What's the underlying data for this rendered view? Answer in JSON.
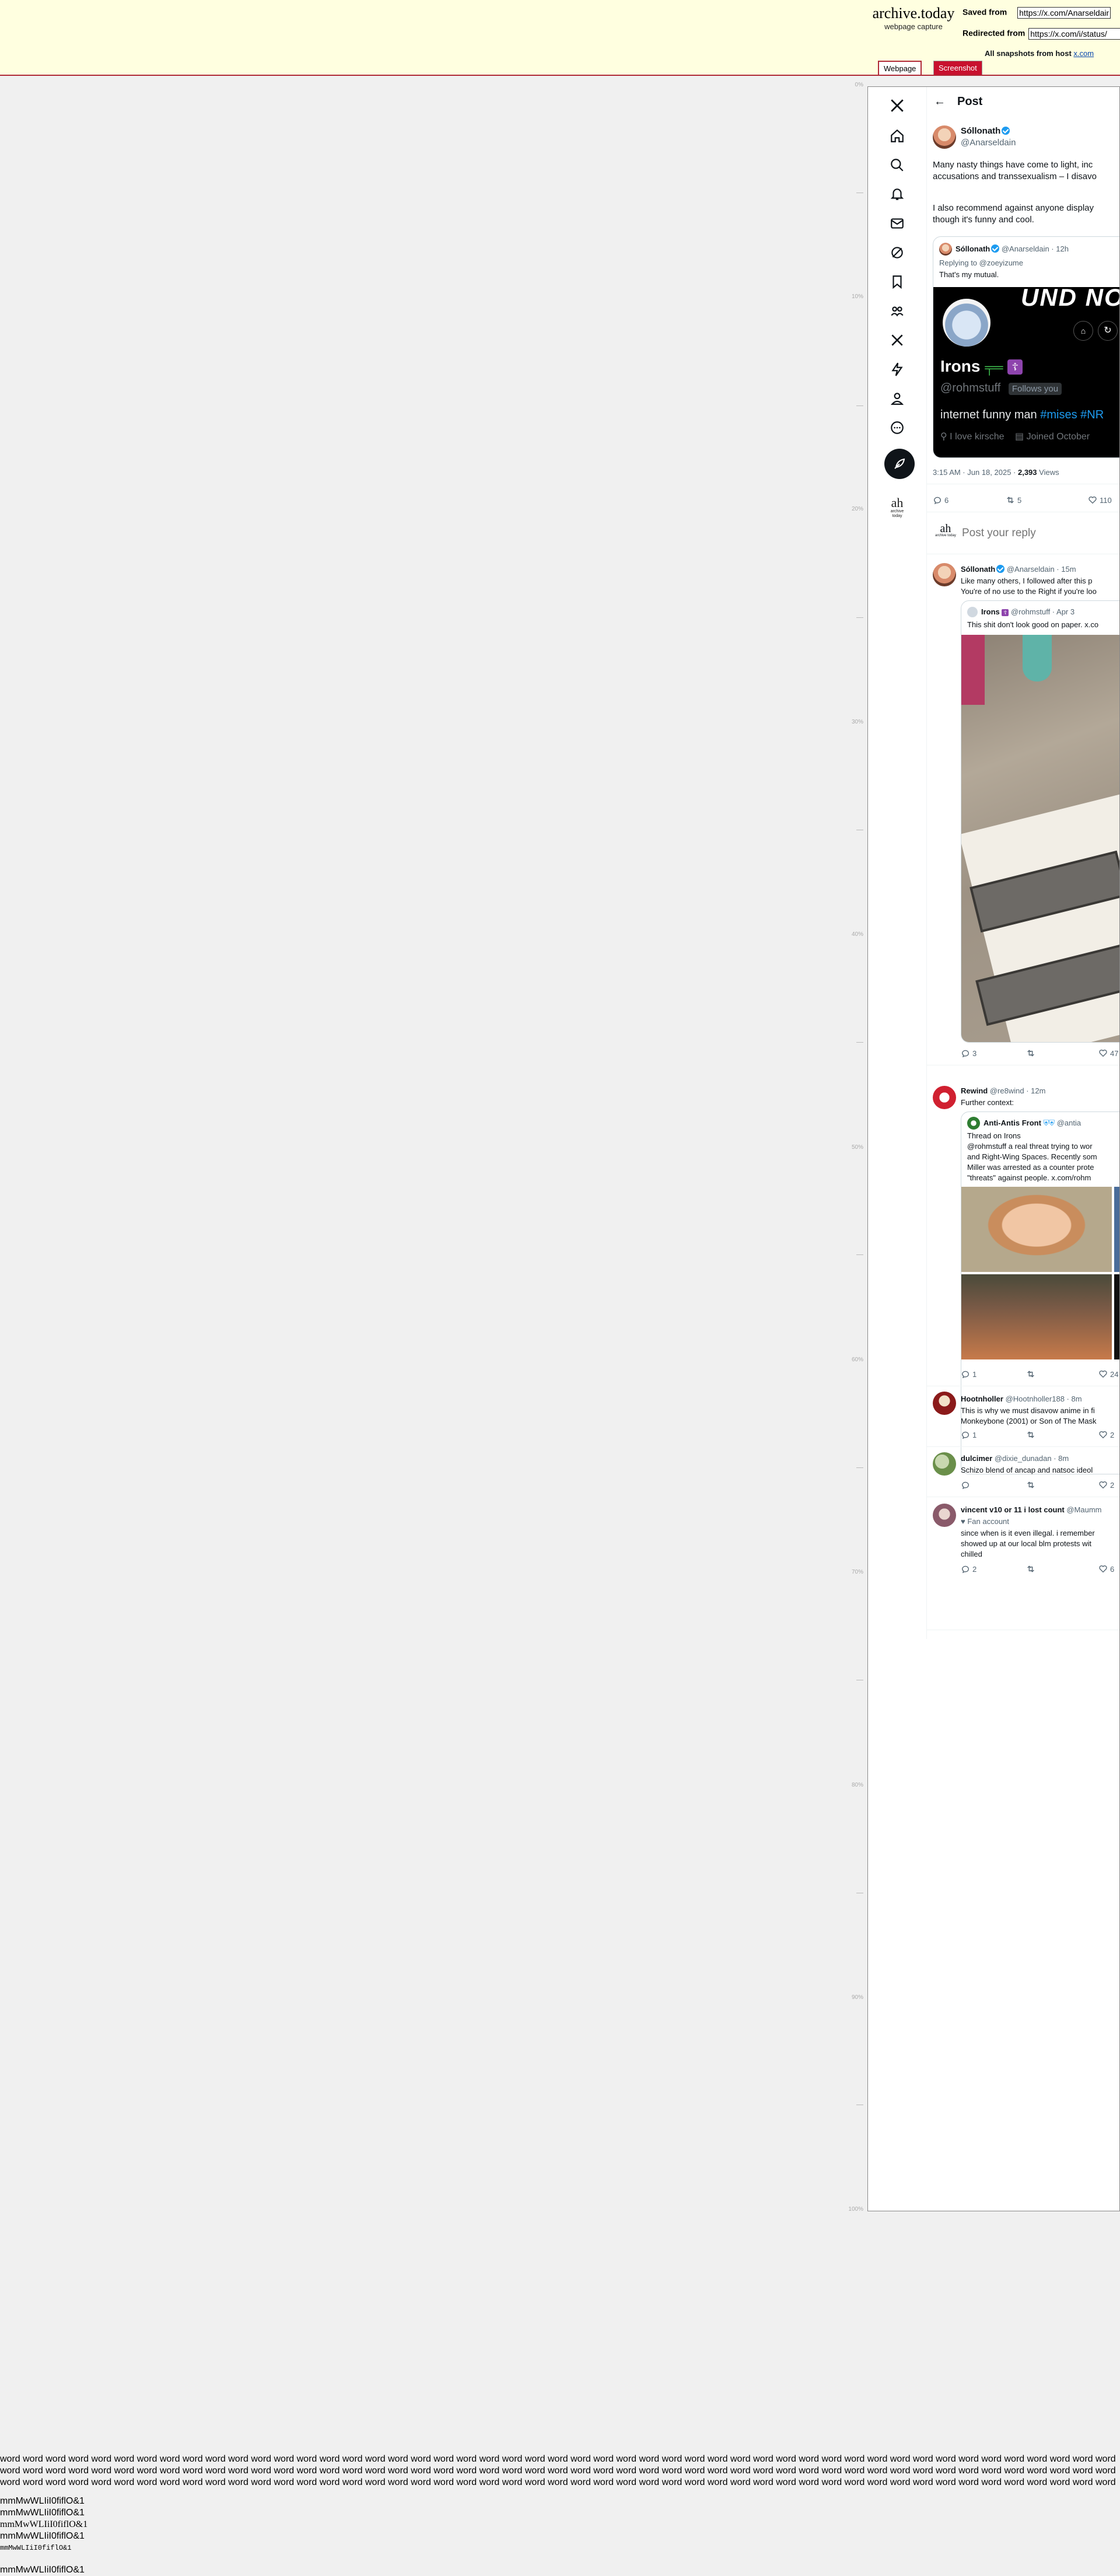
{
  "archive": {
    "site_name": "archive.today",
    "site_sub": "webpage capture",
    "saved_from_label": "Saved from",
    "saved_from_url": "https://x.com/Anarseldain/status/",
    "redirected_from_label": "Redirected from",
    "redirected_from_url": "https://x.com/i/status/",
    "all_snapshots_label": "All snapshots from host",
    "all_snapshots_host": "x.com",
    "tab_webpage": "Webpage",
    "tab_screenshot": "Screenshot",
    "accent_color": "#b02a37"
  },
  "ruler": [
    "0%",
    "10%",
    "20%",
    "30%",
    "40%",
    "50%",
    "60%",
    "70%",
    "80%",
    "90%",
    "100%"
  ],
  "sidebar": {
    "icons": [
      "x-logo-icon",
      "home-icon",
      "search-icon",
      "bell-icon",
      "mail-icon",
      "grok-icon",
      "bookmark-icon",
      "communities-icon",
      "premium-icon",
      "lightning-icon",
      "profile-icon",
      "more-icon"
    ],
    "account_initials": "ah",
    "account_sub": "archive today"
  },
  "header": {
    "title": "Post"
  },
  "main_post": {
    "author": "Sóllonath",
    "handle": "@Anarseldain",
    "text_line1": "Many nasty things have come to light, inc",
    "text_line2": "accusations and transsexualism – I disavo",
    "text_line3": "I also recommend against anyone display",
    "text_line4": "though it's funny and cool.",
    "timestamp": "3:15 AM · Jun 18, 2025 · ",
    "views": "2,393",
    "views_label": " Views",
    "replies": "6",
    "reposts": "5",
    "likes": "110"
  },
  "quoted": {
    "author": "Sóllonath",
    "handle": "@Anarseldain · 12h",
    "replying_to": "Replying to @zoeyizume",
    "text": "That's my mutual.",
    "profile_banner_text": "UND NO",
    "profile_name": "Irons",
    "profile_handle": "@rohmstuff",
    "follows_you": "Follows you",
    "bio_prefix": "internet funny man ",
    "bio_tags": "#mises #NR",
    "location": "I love kirsche",
    "joined": "Joined October"
  },
  "reply_box": {
    "placeholder": "Post your reply"
  },
  "replies": [
    {
      "author": "Sóllonath",
      "meta": "@Anarseldain · 15m",
      "text1": "Like many others, I followed after this p",
      "text2": "You're of no use to the Right if you're loo",
      "quote_author": "Irons",
      "quote_meta": "@rohmstuff · Apr 3",
      "quote_text": "This shit don't look good on paper. x.co",
      "replies": "3",
      "reposts": "",
      "likes": "47"
    },
    {
      "author": "Rewind",
      "meta": "@re8wind · 12m",
      "text1": "Further context:",
      "quote_author": "Anti-Antis Front",
      "quote_meta": "@antia",
      "quote_line1": "Thread on Irons",
      "quote_line2": "@rohmstuff a real threat trying to wor",
      "quote_line3": "and Right-Wing Spaces. Recently som",
      "quote_line4": "Miller was arrested as a counter prote",
      "quote_line5": "\"threats\" against people.  x.com/rohm",
      "replies": "1",
      "reposts": "",
      "likes": "24"
    },
    {
      "author": "Hootnholler",
      "meta": "@Hootnholler188 · 8m",
      "text1": "This is why we must disavow anime in fi",
      "text2": "Monkeybone (2001) or Son of The Mask",
      "replies": "1",
      "reposts": "",
      "likes": "2"
    },
    {
      "author": "dulcimer",
      "meta": "@dixie_dunadan · 8m",
      "text1": "Schizo blend of ancap and natsoc ideol",
      "replies": "",
      "reposts": "",
      "likes": "2"
    },
    {
      "author": "vincent v10 or 11 i lost count",
      "meta": "@Maumm",
      "fan_account": "Fan account",
      "text1": "since when is it even illegal. i remember",
      "text2": "showed up at our local blm protests wit",
      "text3": "chilled",
      "replies": "2",
      "reposts": "",
      "likes": "6"
    }
  ],
  "filler": {
    "words": "word word word word word word word word word word word word word word word word word word word word word word word word word word word word word word word word word word word word word word word word word word word word word word word word word word word word word word word word word word word word word word word word word word word word word word word word word word word word word word word word word word word word word word word word word word word word word word word word word word word word word word word word word word word word word word word word word word word word word word word word word word word word word word word word word word word word word word word word word word word word word word word word word word word word word word word word word word word word word word word word word word word word word word word word word word word word word word word word word word word word word word word word word word word word word",
    "line1": "mmMwWLIiI0fiflO&1",
    "line2": "mmMwWLIiI0fiflO&1",
    "line3": "mmMwWLIiI0fiflO&1",
    "line4": "mmMwWLIiI0fiflO&1",
    "line5": "mmMwWLIiI0fiflO&1",
    "line6": "mmMwWLIiI0fiflO&1"
  }
}
